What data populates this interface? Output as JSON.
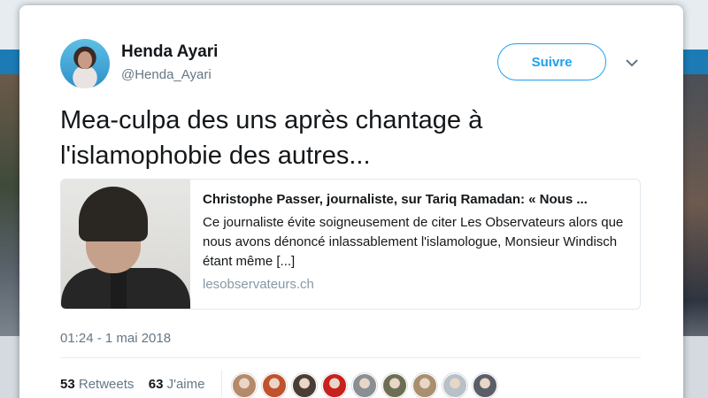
{
  "user": {
    "name": "Henda Ayari",
    "handle": "@Henda_Ayari"
  },
  "follow_button": "Suivre",
  "tweet_text": "Mea-culpa des uns après chantage à l'islamophobie des autres...",
  "link_card": {
    "title": "Christophe Passer, journaliste, sur Tariq Ramadan: « Nous ...",
    "description": "Ce journaliste évite soigneusement de citer Les Observateurs alors que nous avons dénoncé inlassablement l'islamologue, Monsieur Windisch étant même [...]",
    "domain": "lesobservateurs.ch"
  },
  "timestamp": "01:24 - 1 mai 2018",
  "stats": {
    "retweets_count": "53",
    "retweets_label": "Retweets",
    "likes_count": "63",
    "likes_label": "J'aime"
  },
  "liker_avatars": [
    {
      "name": "liker-avatar-1",
      "color": "#b58a6a"
    },
    {
      "name": "liker-avatar-2",
      "color": "#c0522e"
    },
    {
      "name": "liker-avatar-3",
      "color": "#4a3d36"
    },
    {
      "name": "liker-avatar-4",
      "color": "#c8201e"
    },
    {
      "name": "liker-avatar-5",
      "color": "#8a8f94"
    },
    {
      "name": "liker-avatar-6",
      "color": "#6d6f55"
    },
    {
      "name": "liker-avatar-7",
      "color": "#a88f6f"
    },
    {
      "name": "liker-avatar-8",
      "color": "#b8c0c8"
    },
    {
      "name": "liker-avatar-9",
      "color": "#5a5e66"
    }
  ]
}
